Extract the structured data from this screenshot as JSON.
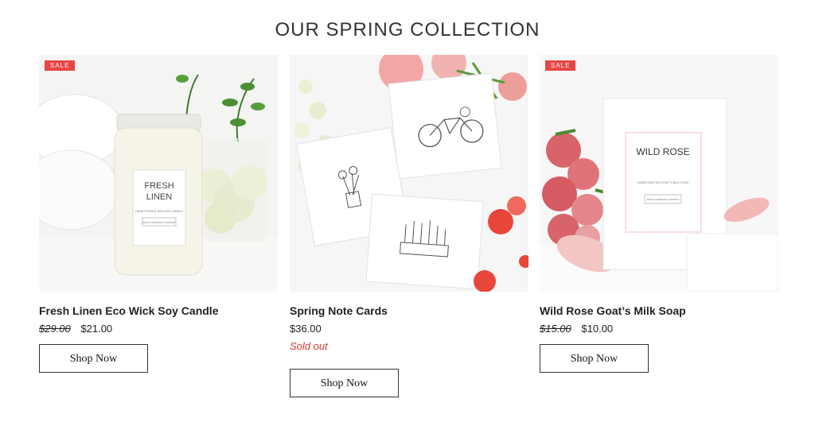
{
  "section": {
    "title": "OUR SPRING COLLECTION"
  },
  "products": [
    {
      "badge": "SALE",
      "name": "Fresh Linen Eco Wick Soy Candle",
      "old_price": "$29.00",
      "price": "$21.00",
      "button": "Shop Now",
      "label_lines": [
        "FRESH",
        "LINEN"
      ],
      "label_sub": "HAND POURED 100% SOY CANDLE",
      "label_brand": "WHITE GARDENIA COMPANY"
    },
    {
      "name": "Spring Note Cards",
      "price": "$36.00",
      "status": "Sold out",
      "button": "Shop Now"
    },
    {
      "badge": "SALE",
      "name": "Wild Rose Goat’s Milk Soap",
      "old_price": "$15.00",
      "price": "$10.00",
      "button": "Shop Now",
      "label_title": "WILD ROSE",
      "label_sub": "HANDCRAFTED GOAT'S MILK SOAP",
      "label_brand": "WHITE GARDENIA COMPANY"
    }
  ],
  "colors": {
    "sale": "#e84545",
    "sold_out": "#d23a2a"
  }
}
